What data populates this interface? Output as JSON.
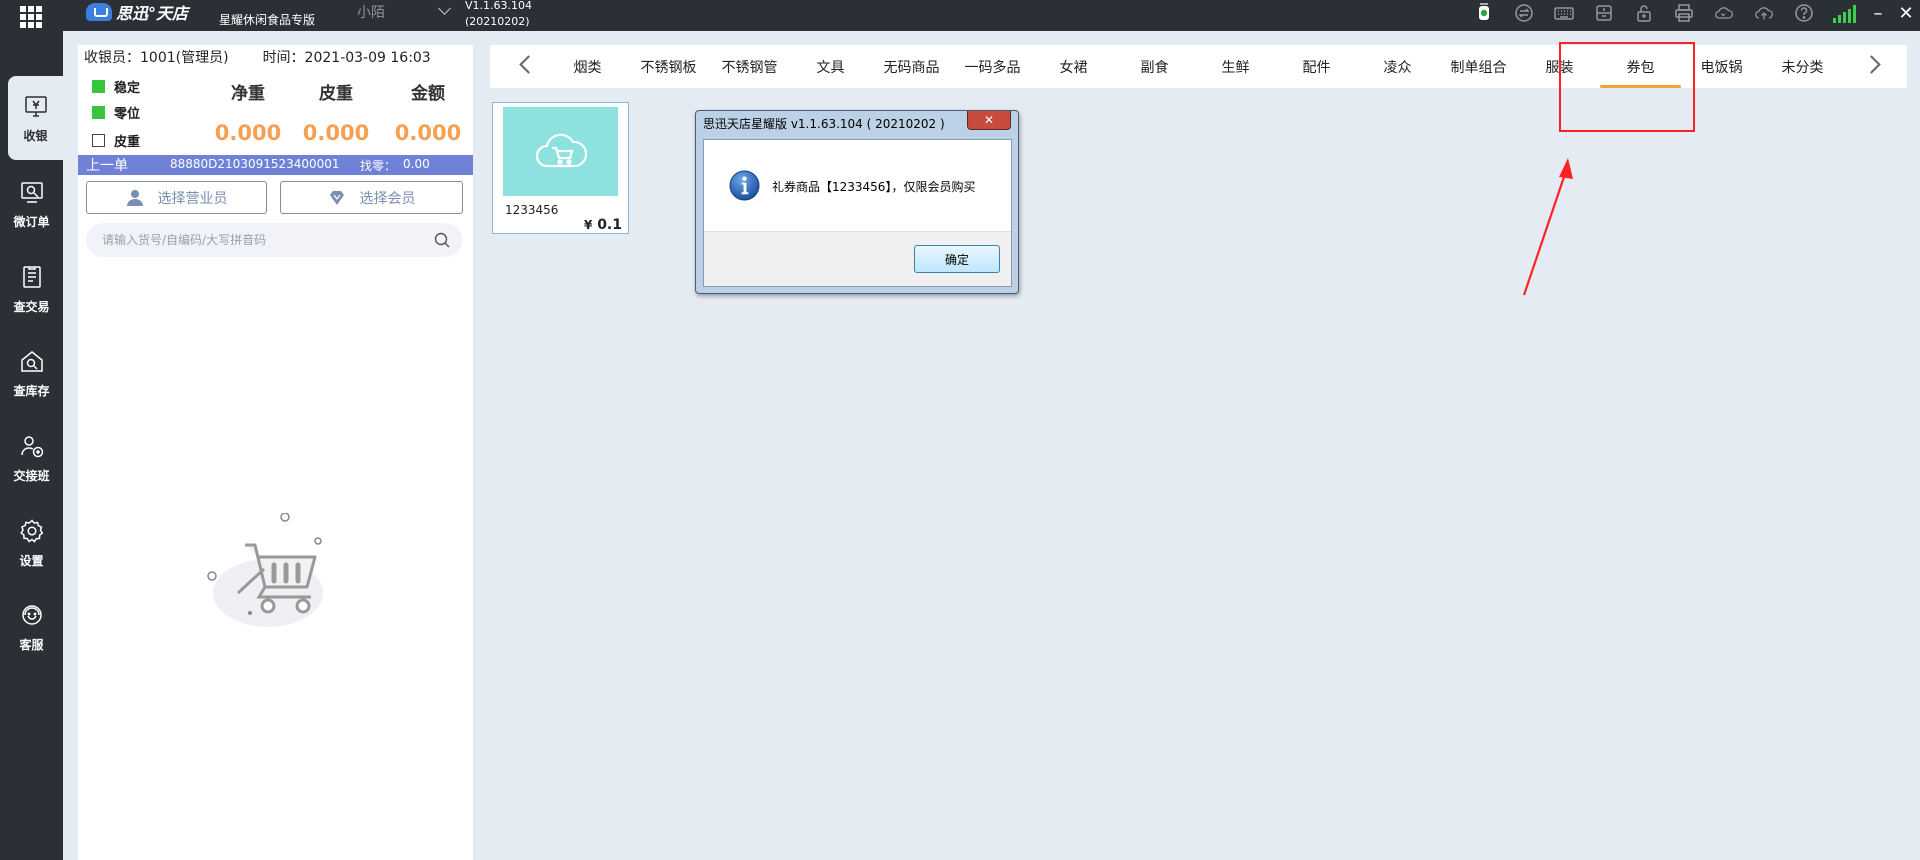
{
  "app": {
    "logo_text": "思迅°天店",
    "edition": "星耀休闲食品专版",
    "user": "小陌",
    "version_line1": "V1.1.63.104",
    "version_line2": "(20210202)"
  },
  "tray_icons": [
    "camera-icon",
    "sync-icon",
    "keyboard-icon",
    "drawer-icon",
    "lock-icon",
    "printer-icon",
    "cloud-sync-icon",
    "cloud-upload-icon",
    "help-icon"
  ],
  "signal": {
    "bars": 5,
    "level": 1.0,
    "color": "#3cd04c"
  },
  "window_controls": {
    "minimize": "–",
    "close": "✕"
  },
  "nav": [
    {
      "label": "收银",
      "icon": "cashier-icon",
      "active": true
    },
    {
      "label": "微订单",
      "icon": "micro-order-icon"
    },
    {
      "label": "查交易",
      "icon": "transactions-icon"
    },
    {
      "label": "查库存",
      "icon": "inventory-icon"
    },
    {
      "label": "交接班",
      "icon": "shift-handover-icon"
    },
    {
      "label": "设置",
      "icon": "settings-icon"
    },
    {
      "label": "客服",
      "icon": "customer-service-icon"
    }
  ],
  "cashier": {
    "cashier_label": "收银员：1001(管理员)",
    "time_label": "时间：2021-03-09 16:03",
    "indicators": [
      {
        "label": "稳定",
        "state": "on"
      },
      {
        "label": "零位",
        "state": "on"
      },
      {
        "label": "皮重",
        "state": "off"
      }
    ],
    "headers": [
      "净重",
      "皮重",
      "金额"
    ],
    "values": [
      "0.000",
      "0.000",
      "0.000"
    ],
    "last_order_label": "上一单",
    "last_order_no": "88880D2103091523400001",
    "change_label": "找零：",
    "change_value": "0.00",
    "select_clerk": "选择营业员",
    "select_member": "选择会员",
    "search_placeholder": "请输入货号/自编码/大写拼音码"
  },
  "categories": {
    "items": [
      "烟类",
      "不锈钢板",
      "不锈钢管",
      "文具",
      "无码商品",
      "一码多品",
      "女裙",
      "副食",
      "生鲜",
      "配件",
      "凌众",
      "制单组合",
      "服装",
      "券包",
      "电饭锅",
      "未分类"
    ],
    "active": "券包",
    "accent": "#f0a636"
  },
  "products": [
    {
      "code": "1233456",
      "price_symbol": "¥",
      "price": "0.1",
      "image": "cloud-cart-icon"
    }
  ],
  "dialog": {
    "title": "思迅天店星耀版 v1.1.63.104 ( 20210202 )",
    "close": "✕",
    "message": "礼券商品【1233456】，仅限会员购买",
    "ok": "确定",
    "icon": "info-icon"
  },
  "annotation": {
    "color": "#ff2222"
  }
}
